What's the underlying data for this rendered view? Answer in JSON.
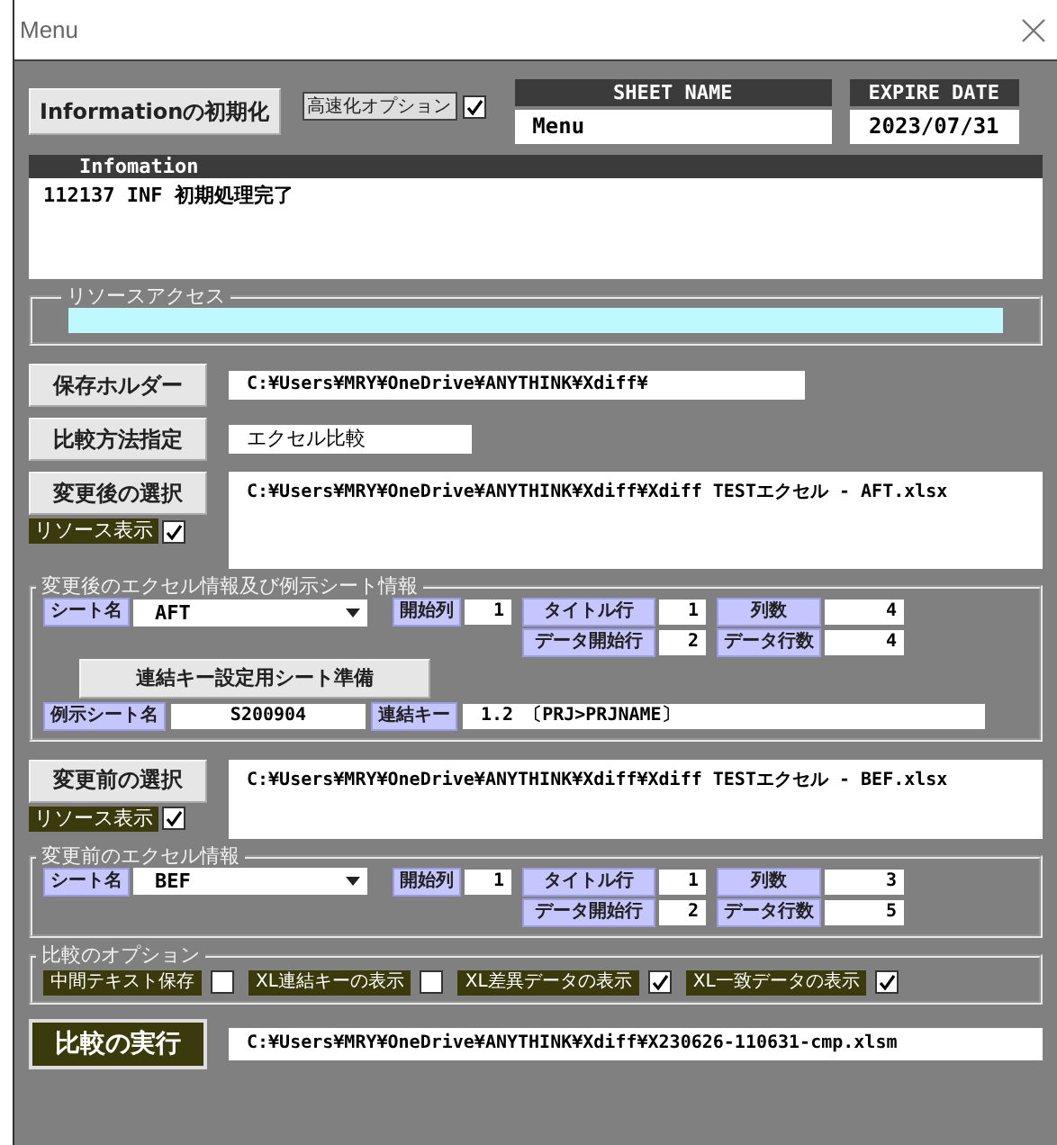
{
  "window": {
    "title": "Menu"
  },
  "header": {
    "init_button": "Informationの初期化",
    "speed_option": {
      "label": "高速化オプション",
      "checked": true
    },
    "sheet_name": {
      "label": "SHEET NAME",
      "value": "Menu"
    },
    "expire_date": {
      "label": "EXPIRE DATE",
      "value": "2023/07/31"
    }
  },
  "info": {
    "title": "Infomation",
    "lines": [
      "112137 INF 初期処理完了"
    ]
  },
  "resource_access": {
    "title": "リソースアクセス"
  },
  "save_folder": {
    "button": "保存ホルダー",
    "value": "C:¥Users¥MRY¥OneDrive¥ANYTHINK¥Xdiff¥"
  },
  "compare_method": {
    "button": "比較方法指定",
    "value": "エクセル比較"
  },
  "after_select": {
    "button": "変更後の選択",
    "resource_display": {
      "label": "リソース表示",
      "checked": true
    },
    "path": "C:¥Users¥MRY¥OneDrive¥ANYTHINK¥Xdiff¥Xdiff TESTエクセル - AFT.xlsx"
  },
  "after_info": {
    "title": "変更後のエクセル情報及び例示シート情報",
    "sheet_label": "シート名",
    "sheet": "AFT",
    "fields": [
      {
        "label": "開始列",
        "value": "1"
      },
      {
        "label": "タイトル行",
        "value": "1"
      },
      {
        "label": "列数",
        "value": "4"
      },
      {
        "label": "データ開始行",
        "value": "2"
      },
      {
        "label": "データ行数",
        "value": "4"
      }
    ],
    "prepare_button": "連結キー設定用シート準備",
    "example_label": "例示シート名",
    "example_value": "S200904",
    "key_label": "連結キー",
    "key_value": "1.2 〔PRJ>PRJNAME〕"
  },
  "before_select": {
    "button": "変更前の選択",
    "resource_display": {
      "label": "リソース表示",
      "checked": true
    },
    "path": "C:¥Users¥MRY¥OneDrive¥ANYTHINK¥Xdiff¥Xdiff TESTエクセル - BEF.xlsx"
  },
  "before_info": {
    "title": "変更前のエクセル情報",
    "sheet_label": "シート名",
    "sheet": "BEF",
    "fields": [
      {
        "label": "開始列",
        "value": "1"
      },
      {
        "label": "タイトル行",
        "value": "1"
      },
      {
        "label": "列数",
        "value": "3"
      },
      {
        "label": "データ開始行",
        "value": "2"
      },
      {
        "label": "データ行数",
        "value": "5"
      }
    ]
  },
  "compare_options": {
    "title": "比較のオプション",
    "options": [
      {
        "label": "中間テキスト保存",
        "checked": false
      },
      {
        "label": "XL連結キーの表示",
        "checked": false
      },
      {
        "label": "XL差異データの表示",
        "checked": true
      },
      {
        "label": "XL一致データの表示",
        "checked": true
      }
    ]
  },
  "execute": {
    "button": "比較の実行",
    "path": "C:¥Users¥MRY¥OneDrive¥ANYTHINK¥Xdiff¥X230626-110631-cmp.xlsm"
  }
}
